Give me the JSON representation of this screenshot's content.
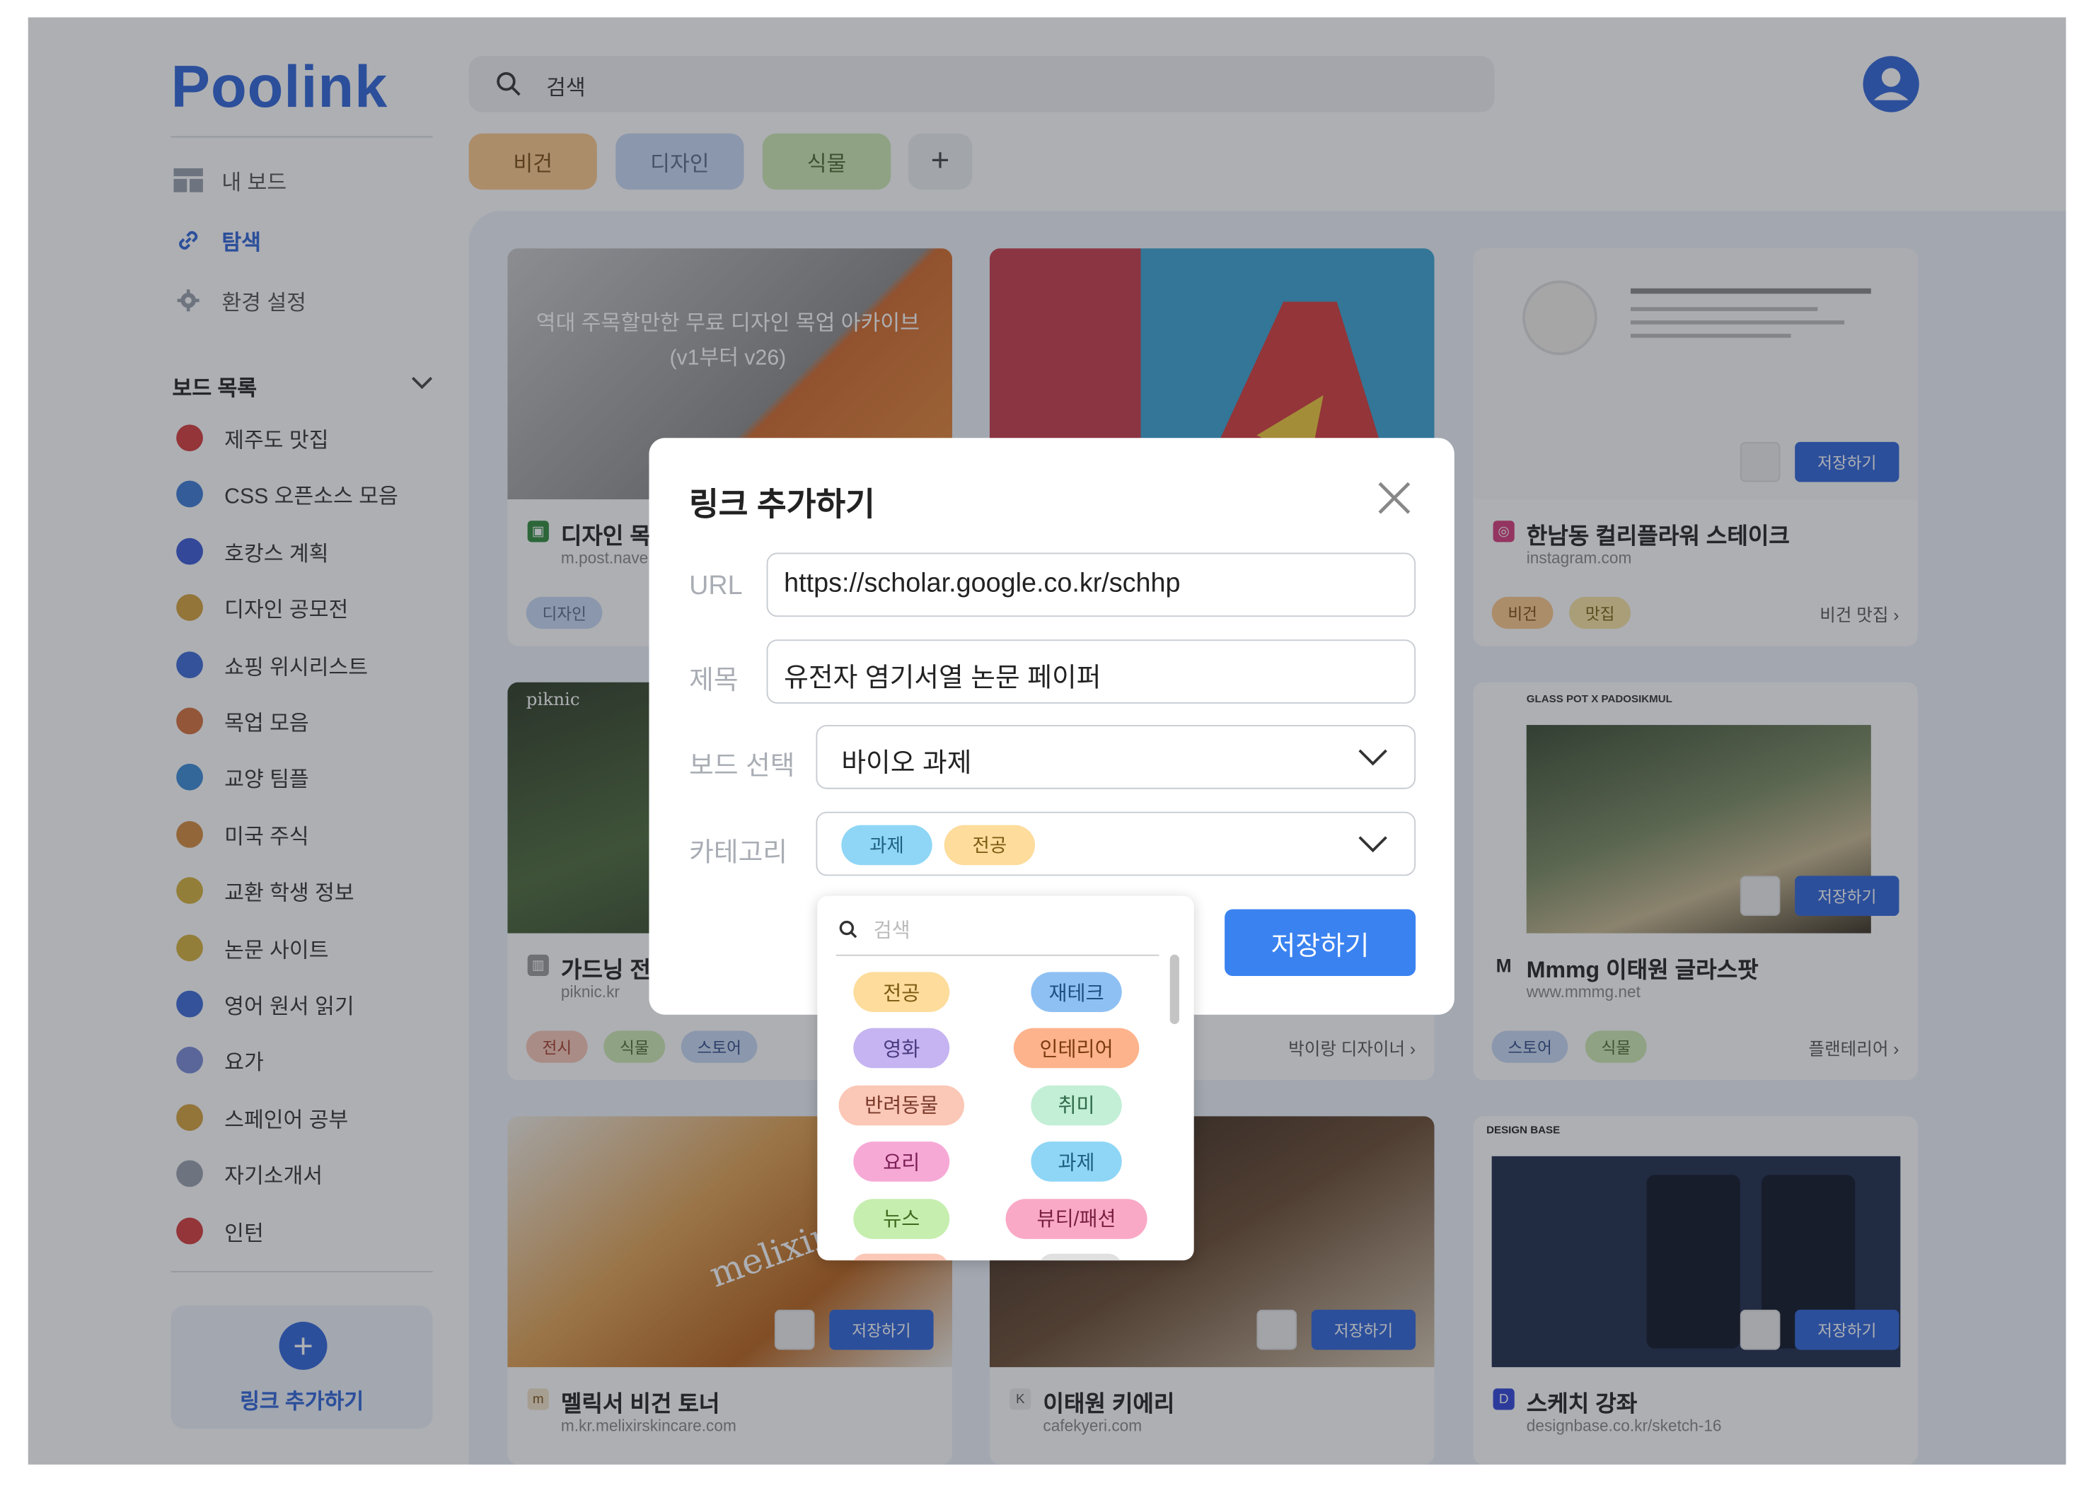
{
  "app": {
    "logo": "Poolink"
  },
  "nav": [
    {
      "label": "내 보드",
      "icon": "board-icon"
    },
    {
      "label": "탐색",
      "icon": "link-icon",
      "active": true
    },
    {
      "label": "환경 설정",
      "icon": "gear-icon"
    }
  ],
  "boards_header": "보드 목록",
  "boards": [
    "제주도 맛집",
    "CSS 오픈소스 모음",
    "호캉스 계획",
    "디자인 공모전",
    "쇼핑 위시리스트",
    "목업 모음",
    "교양 팀플",
    "미국 주식",
    "교환 학생 정보",
    "논문 사이트",
    "영어 원서 읽기",
    "요가",
    "스페인어 공부",
    "자기소개서",
    "인턴"
  ],
  "add_link_button": "링크 추가하기",
  "search": {
    "placeholder": "검색"
  },
  "filter_chips": [
    {
      "label": "비건",
      "bg": "#fdc88a",
      "color": "#7a4d10"
    },
    {
      "label": "디자인",
      "bg": "#c9d8f4",
      "color": "#5a6a88"
    },
    {
      "label": "식물",
      "bg": "#cfeab2",
      "color": "#4e6a30"
    }
  ],
  "add_chip": "+",
  "cards": [
    {
      "title": "디자인 목업",
      "url": "m.post.naver.com",
      "tags": [
        "디자인"
      ],
      "img_text": "역대 주목할만한 무료 디자인 목업 아카이브(v1부터 v26)"
    },
    {
      "title": "",
      "url": "",
      "tags": []
    },
    {
      "title": "한남동 컬리플라워 스테이크",
      "url": "instagram.com",
      "tags": [
        "비건",
        "맛집"
      ],
      "category": "비건 맛집",
      "save": "저장하기"
    },
    {
      "title": "가드닝 전시",
      "url": "piknic.kr",
      "tags": [
        "전시",
        "식물",
        "스토어"
      ],
      "img_label": "piknic"
    },
    {
      "title": "",
      "url": "",
      "tags": [],
      "category": "박이랑 디자이너"
    },
    {
      "title": "Mmmg 이태원 글라스팟",
      "url": "www.mmmg.net",
      "tags": [
        "스토어",
        "식물"
      ],
      "category": "플랜테리어",
      "save": "저장하기",
      "img_label": "GLASS POT X PADOSIKMUL"
    },
    {
      "title": "멜릭서 비건 토너",
      "url": "m.kr.melixirskincare.com",
      "save": "저장하기",
      "img_label": "melixir"
    },
    {
      "title": "이태원 키에리",
      "url": "cafekyeri.com",
      "save": "저장하기"
    },
    {
      "title": "스케치 강좌",
      "url": "designbase.co.kr/sketch-16",
      "save": "저장하기",
      "img_label": "DESIGN BASE"
    }
  ],
  "modal": {
    "title": "링크 추가하기",
    "url_label": "URL",
    "url_value": "https://scholar.google.co.kr/schhp",
    "title_label": "제목",
    "title_value": "유전자 염기서열 논문 페이퍼",
    "board_label": "보드 선택",
    "board_value": "바이오 과제",
    "category_label": "카테고리",
    "selected_categories": [
      {
        "label": "과제",
        "bg": "#8fd6f6",
        "color": "#1e5f7e"
      },
      {
        "label": "전공",
        "bg": "#fddc9c",
        "color": "#7a5a10"
      }
    ],
    "save_button": "저장하기"
  },
  "category_dropdown": {
    "search_placeholder": "검색",
    "options": [
      {
        "label": "전공",
        "bg": "#fddc9c",
        "color": "#7a5a10"
      },
      {
        "label": "재테크",
        "bg": "#8ec0f3",
        "color": "#1e4f80"
      },
      {
        "label": "영화",
        "bg": "#c5b4f1",
        "color": "#4a3a80"
      },
      {
        "label": "인테리어",
        "bg": "#fdb38c",
        "color": "#7a3a10"
      },
      {
        "label": "반려동물",
        "bg": "#fbc7b6",
        "color": "#7a3a2a"
      },
      {
        "label": "취미",
        "bg": "#c2efd6",
        "color": "#2f6a4a"
      },
      {
        "label": "요리",
        "bg": "#f7a9d6",
        "color": "#7a1f55"
      },
      {
        "label": "과제",
        "bg": "#8fd6f6",
        "color": "#1e5f7e"
      },
      {
        "label": "뉴스",
        "bg": "#c6eeaf",
        "color": "#3f6a20"
      },
      {
        "label": "뷰티/패션",
        "bg": "#f9a9c6",
        "color": "#7a1f40"
      }
    ]
  }
}
